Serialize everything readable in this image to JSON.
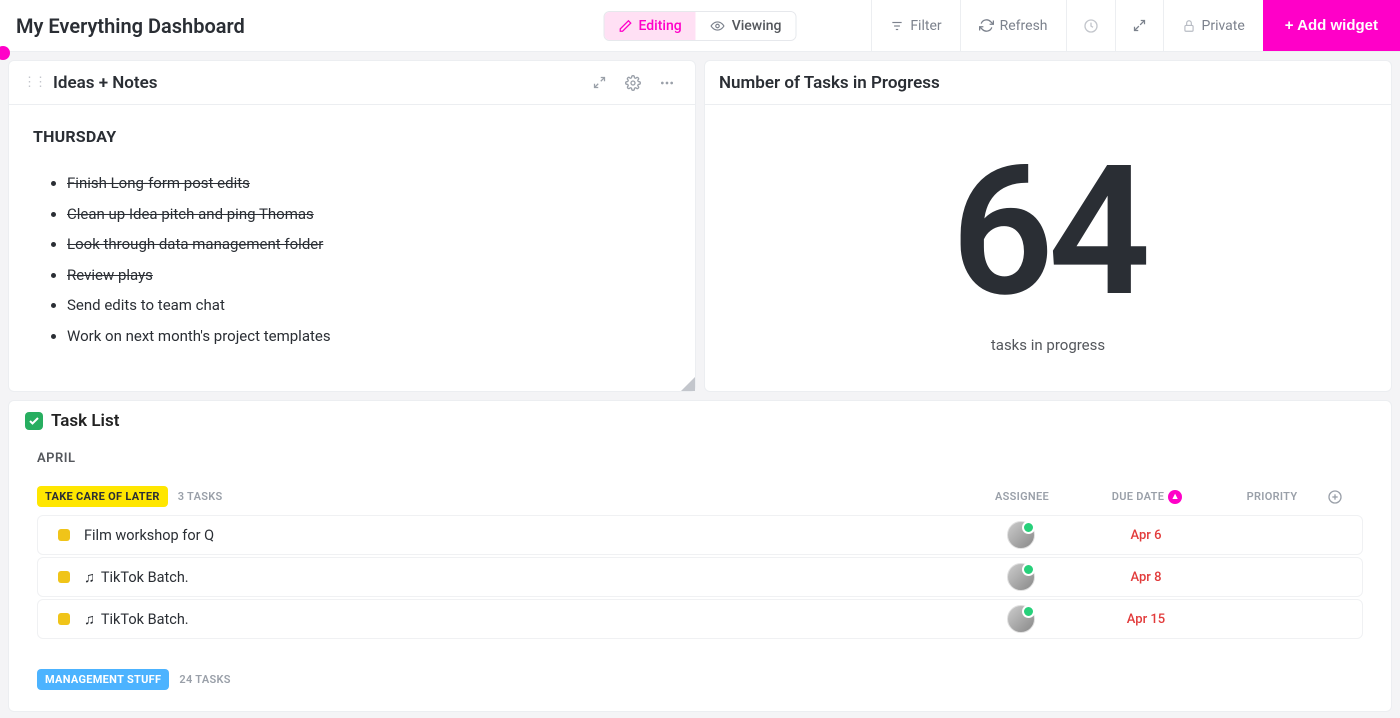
{
  "header": {
    "title": "My Everything Dashboard",
    "modes": {
      "editing": "Editing",
      "viewing": "Viewing"
    },
    "filter": "Filter",
    "refresh": "Refresh",
    "private": "Private",
    "add_widget": "+ Add widget"
  },
  "notes": {
    "title": "Ideas + Notes",
    "heading": "THURSDAY",
    "items": [
      {
        "text": "Finish Long-form post edits",
        "done": true
      },
      {
        "text": "Clean up Idea pitch and ping Thomas",
        "done": true
      },
      {
        "text": "Look through data management folder",
        "done": true
      },
      {
        "text": "Review plays",
        "done": true
      },
      {
        "text": "Send edits to team chat",
        "done": false
      },
      {
        "text": "Work on next month's project templates",
        "done": false
      }
    ]
  },
  "counter": {
    "title": "Number of Tasks in Progress",
    "value": "64",
    "label": "tasks in progress"
  },
  "tasklist": {
    "title": "Task List",
    "month": "APRIL",
    "columns": {
      "assignee": "ASSIGNEE",
      "due": "DUE DATE",
      "priority": "PRIORITY"
    },
    "groups": [
      {
        "name": "TAKE CARE OF LATER",
        "chip": "yellow",
        "count_label": "3 TASKS",
        "tasks": [
          {
            "name": "Film workshop for Q",
            "icon": null,
            "due": "Apr 6"
          },
          {
            "name": "TikTok Batch.",
            "icon": "music",
            "due": "Apr 8"
          },
          {
            "name": "TikTok Batch.",
            "icon": "music",
            "due": "Apr 15"
          }
        ]
      },
      {
        "name": "MANAGEMENT STUFF",
        "chip": "blue",
        "count_label": "24 TASKS",
        "tasks": []
      }
    ]
  }
}
